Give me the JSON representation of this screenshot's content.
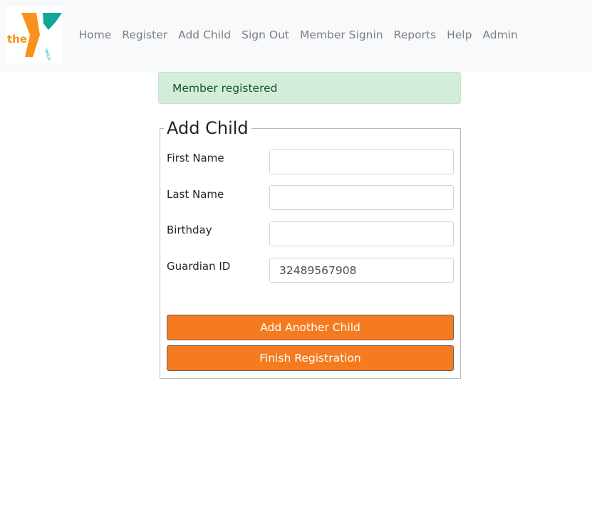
{
  "nav": {
    "logo": {
      "word": "the",
      "small": "YMCA",
      "icon": "ymca-logo"
    },
    "links": [
      "Home",
      "Register",
      "Add Child",
      "Sign Out",
      "Member Signin",
      "Reports",
      "Help",
      "Admin"
    ]
  },
  "alert": {
    "message": "Member registered",
    "status_color": "#d4edda"
  },
  "form": {
    "legend": "Add Child",
    "fields": [
      {
        "label": "First Name",
        "value": "",
        "placeholder": ""
      },
      {
        "label": "Last Name",
        "value": "",
        "placeholder": ""
      },
      {
        "label": "Birthday",
        "value": "",
        "placeholder": ""
      },
      {
        "label": "Guardian ID",
        "value": "32489567908",
        "placeholder": ""
      }
    ],
    "buttons": {
      "add_another": "Add Another Child",
      "finish": "Finish Registration"
    }
  },
  "colors": {
    "accent": "#f47b20",
    "logo_orange": "#f7931d",
    "logo_teal": "#11a59b",
    "navbar_bg": "#f8f9fa"
  }
}
